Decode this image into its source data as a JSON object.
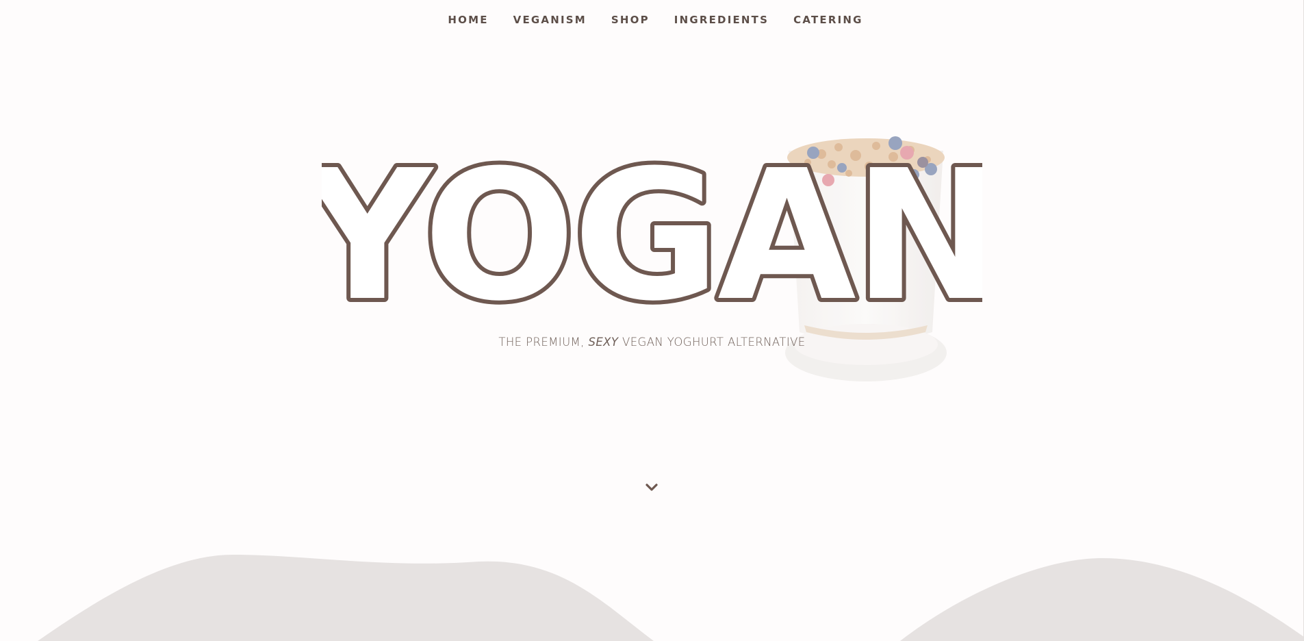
{
  "nav": {
    "items": [
      {
        "label": "HOME"
      },
      {
        "label": "VEGANISM"
      },
      {
        "label": "SHOP"
      },
      {
        "label": "INGREDIENTS"
      },
      {
        "label": "CATERING"
      }
    ]
  },
  "hero": {
    "brand": "YOGAN",
    "tagline_prefix": "THE PREMIUM, ",
    "tagline_emphasis": "SEXY",
    "tagline_suffix": " VEGAN YOGHURT ALTERNATIVE",
    "image": "yoghurt-parfait-glass",
    "scroll_icon": "chevron-down-icon"
  },
  "colors": {
    "brand_brown": "#6e5850",
    "nav_text": "#5c4e48",
    "wave": "#e6e2e1",
    "background": "#fefcfc"
  }
}
